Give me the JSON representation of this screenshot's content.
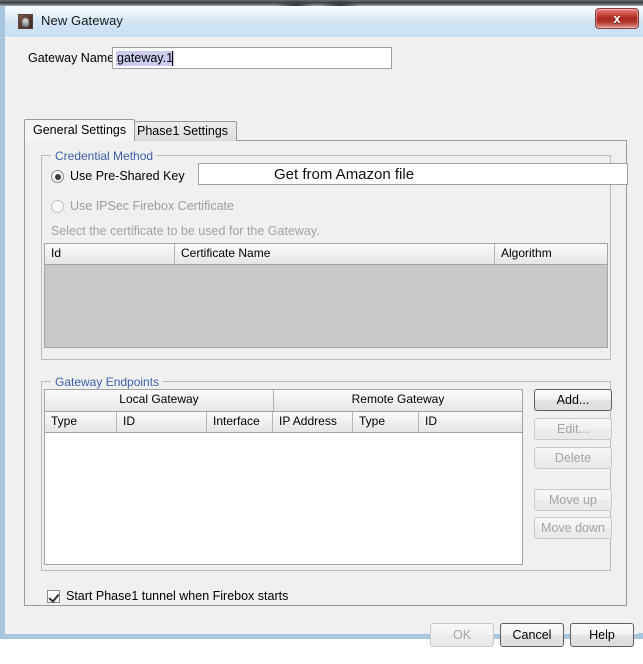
{
  "window": {
    "title": "New Gateway",
    "icon": "app-icon",
    "close_label": "x",
    "frame_color": "#a8c6dd",
    "titlebar_color": "#cfe3f4",
    "close_color": "#ab2820"
  },
  "form": {
    "gateway_name_label": "Gateway Name:",
    "gateway_name_value": "gateway.1",
    "gateway_name_placeholder": ""
  },
  "tabs": [
    {
      "label": "General Settings",
      "active": true
    },
    {
      "label": "Phase1 Settings",
      "active": false
    }
  ],
  "credential_method": {
    "group_title": "Credential Method",
    "group_title_color": "#3b5ea8",
    "options": [
      {
        "label": "Use Pre-Shared Key",
        "selected": true,
        "disabled": false
      },
      {
        "label": "Use IPSec Firebox Certificate",
        "selected": false,
        "disabled": true
      }
    ],
    "psk_value": "Get from Amazon file",
    "psk_placeholder": "",
    "certificate_hint": "Select the certificate to be used for the Gateway.",
    "certificate_table": {
      "columns": [
        "Id",
        "Certificate Name",
        "Algorithm"
      ],
      "rows": [],
      "disabled": true
    }
  },
  "gateway_endpoints": {
    "group_title": "Gateway Endpoints",
    "group_title_color": "#3b5ea8",
    "table": {
      "group_headers": [
        "Local Gateway",
        "Remote Gateway"
      ],
      "columns": [
        "Type",
        "ID",
        "Interface",
        "IP Address",
        "Type",
        "ID"
      ],
      "rows": []
    },
    "buttons": [
      {
        "label": "Add...",
        "disabled": false
      },
      {
        "label": "Edit...",
        "disabled": true
      },
      {
        "label": "Delete",
        "disabled": true
      },
      {
        "label": "Move up",
        "disabled": true
      },
      {
        "label": "Move down",
        "disabled": true
      }
    ]
  },
  "start_phase1": {
    "label": "Start Phase1 tunnel when Firebox starts",
    "checked": true
  },
  "dialog_buttons": [
    {
      "label": "OK",
      "disabled": true
    },
    {
      "label": "Cancel",
      "disabled": false
    },
    {
      "label": "Help",
      "disabled": false
    }
  ]
}
